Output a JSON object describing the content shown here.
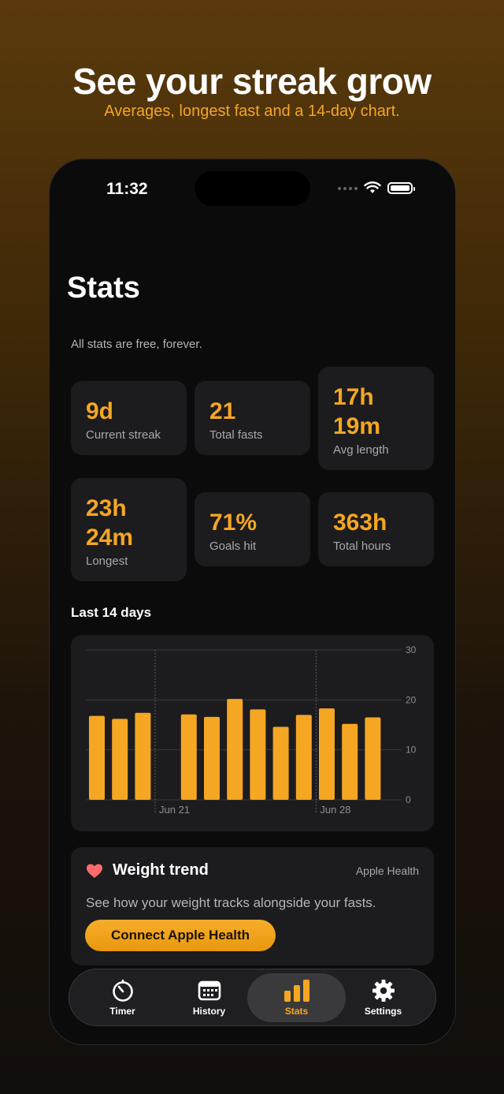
{
  "hero": {
    "title": "See your streak grow",
    "subtitle": "Averages, longest fast and a 14-day chart."
  },
  "status_bar": {
    "time": "11:32",
    "icons": [
      "signal-dots-icon",
      "wifi-icon",
      "battery-icon"
    ]
  },
  "page": {
    "title": "Stats",
    "subtitle": "All stats are free, forever."
  },
  "stats": [
    {
      "value": "9d",
      "label": "Current streak"
    },
    {
      "value": "21",
      "label": "Total fasts"
    },
    {
      "value": "17h 19m",
      "line1": "17h",
      "line2": "19m",
      "label": "Avg length"
    },
    {
      "value": "23h 24m",
      "line1": "23h",
      "line2": "24m",
      "label": "Longest"
    },
    {
      "value": "71%",
      "label": "Goals hit"
    },
    {
      "value": "363h",
      "label": "Total hours"
    }
  ],
  "chart_section_title": "Last 14 days",
  "chart_data": {
    "type": "bar",
    "x_tick_labels": [
      "Jun 21",
      "Jun 28"
    ],
    "values": [
      16.8,
      16.2,
      17.4,
      0,
      17.1,
      16.6,
      20.2,
      18.1,
      14.6,
      17.0,
      18.3,
      15.2,
      16.5
    ],
    "y_ticks": [
      0,
      10,
      20,
      30
    ],
    "ylim": [
      0,
      30
    ],
    "grid": true,
    "bar_color": "#f5a623",
    "y_axis_side": "right"
  },
  "weight": {
    "icon": "heart-icon",
    "title": "Weight trend",
    "source": "Apple Health",
    "description": "See how your weight tracks alongside your fasts.",
    "button_label": "Connect Apple Health"
  },
  "tabs": [
    {
      "label": "Timer",
      "icon": "timer-icon",
      "active": false
    },
    {
      "label": "History",
      "icon": "calendar-icon",
      "active": false
    },
    {
      "label": "Stats",
      "icon": "bar-chart-icon",
      "active": true
    },
    {
      "label": "Settings",
      "icon": "gear-icon",
      "active": false
    }
  ],
  "colors": {
    "accent": "#f5a623",
    "card": "#1c1c1e",
    "background": "#0b0b0c"
  }
}
